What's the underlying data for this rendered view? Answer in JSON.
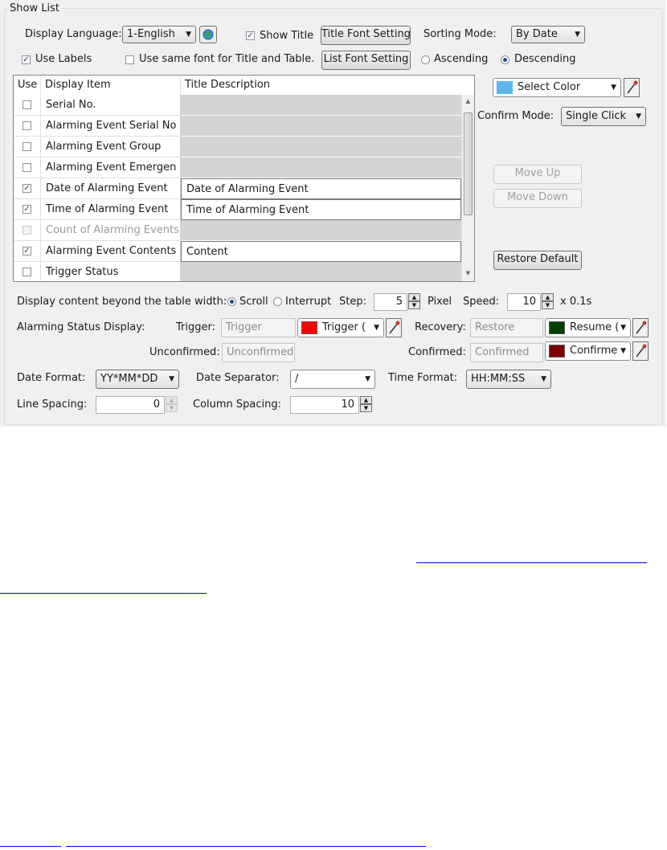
{
  "group_title": "Show List",
  "row1": {
    "display_language_label": "Display Language:",
    "display_language_value": "1-English",
    "show_title_label": "Show Title",
    "show_title_checked": true,
    "title_font_button": "Title Font Setting",
    "sorting_mode_label": "Sorting Mode:",
    "sorting_mode_value": "By Date"
  },
  "row2": {
    "use_labels_label": "Use Labels",
    "use_labels_checked": true,
    "same_font_label": "Use same font for Title and Table.",
    "same_font_checked": false,
    "list_font_button": "List Font Setting",
    "ascending_label": "Ascending",
    "descending_label": "Descending",
    "sort_order": "Descending"
  },
  "table": {
    "headers": {
      "use": "Use",
      "item": "Display Item",
      "desc": "Title Description"
    },
    "rows": [
      {
        "item": "Serial No.",
        "desc": "",
        "checked": false,
        "enabled": true
      },
      {
        "item": "Alarming Event Serial No",
        "desc": "",
        "checked": false,
        "enabled": true
      },
      {
        "item": "Alarming Event Group",
        "desc": "",
        "checked": false,
        "enabled": true
      },
      {
        "item": "Alarming Event Emergen",
        "desc": "",
        "checked": false,
        "enabled": true
      },
      {
        "item": "Date of Alarming Event",
        "desc": "Date of Alarming Event",
        "checked": true,
        "enabled": true
      },
      {
        "item": "Time of Alarming Event",
        "desc": "Time of Alarming Event",
        "checked": true,
        "enabled": true
      },
      {
        "item": "Count of Alarming Events",
        "desc": "",
        "checked": false,
        "enabled": false
      },
      {
        "item": "Alarming Event Contents",
        "desc": "Content",
        "checked": true,
        "enabled": true
      },
      {
        "item": "Trigger Status",
        "desc": "",
        "checked": false,
        "enabled": true
      }
    ]
  },
  "side": {
    "select_color_label": "Select Color",
    "select_color_swatch": "#5bb8ec",
    "confirm_mode_label": "Confirm Mode:",
    "confirm_mode_value": "Single Click",
    "move_up": "Move Up",
    "move_down": "Move Down",
    "restore_default": "Restore Default"
  },
  "scroll_row": {
    "label": "Display content beyond the table width:",
    "scroll_label": "Scroll",
    "interrupt_label": "Interrupt",
    "mode": "Scroll",
    "step_label": "Step:",
    "step_value": "5",
    "pixel_label": "Pixel",
    "speed_label": "Speed:",
    "speed_value": "10",
    "speed_unit": "x 0.1s"
  },
  "status": {
    "label": "Alarming Status Display:",
    "trigger_label": "Trigger:",
    "trigger_value": "Trigger",
    "trigger_color_text": "Trigger (",
    "trigger_color": "#ff0000",
    "recovery_label": "Recovery:",
    "recovery_value": "Restore",
    "recovery_color_text": "Resume (",
    "recovery_color": "#004000",
    "unconfirmed_label": "Unconfirmed:",
    "unconfirmed_value": "Unconfirmed",
    "confirmed_label": "Confirmed:",
    "confirmed_value": "Confirmed",
    "confirmed_color_text": "Confirme",
    "confirmed_color": "#800000"
  },
  "format": {
    "date_format_label": "Date Format:",
    "date_format_value": "YY*MM*DD",
    "date_sep_label": "Date Separator:",
    "date_sep_value": "/",
    "time_format_label": "Time Format:",
    "time_format_value": "HH:MM:SS"
  },
  "spacing": {
    "line_label": "Line Spacing:",
    "line_value": "0",
    "column_label": "Column Spacing:",
    "column_value": "10"
  },
  "colors": {
    "link": "#0000ee",
    "panel": "#f0f0f0"
  }
}
